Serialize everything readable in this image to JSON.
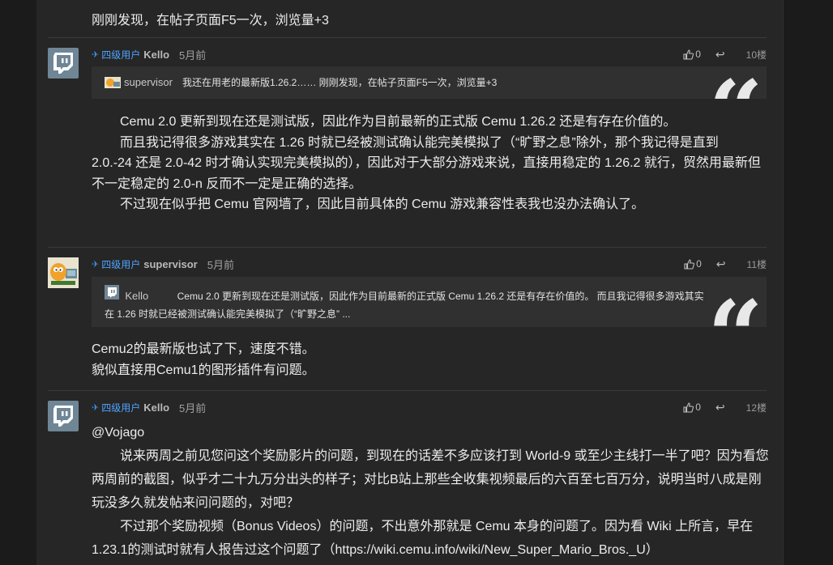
{
  "top_line": "刚刚发现，在帖子页面F5一次，浏览量+3",
  "colors": {
    "background": "#1b1b1b",
    "column": "#262626",
    "quote_bg": "#303030",
    "level": "#4da3ff"
  },
  "posts": [
    {
      "level": "四级用户",
      "user": "Kello",
      "time": "5月前",
      "likes": "0",
      "floor": "10楼",
      "avatar_icon": "twitch-icon",
      "quote": {
        "user": "supervisor",
        "text": "我还在用老的最新版1.26.2…… 刚刚发现，在帖子页面F5一次，浏览量+3"
      },
      "body": [
        "Cemu 2.0 更新到现在还是测试版，因此作为目前最新的正式版 Cemu 1.26.2 还是有存在价值的。",
        "而且我记得很多游戏其实在 1.26 时就已经被测试确认能完美模拟了（“旷野之息”除外，那个我记得是直到",
        " 2.0.-24 还是 2.0-42 时才确认实现完美模拟的），因此对于大部分游戏来说，直接用稳定的 1.26.2 就行，贸然用最新但不一定稳定的 2.0-n 反而不一定是正确的选择。",
        "不过现在似乎把 Cemu 官网墙了，因此目前具体的 Cemu 游戏兼容性表我也没办法确认了。"
      ]
    },
    {
      "level": "四级用户",
      "user": "supervisor",
      "time": "5月前",
      "likes": "0",
      "floor": "11楼",
      "avatar_icon": "garfield-avatar",
      "quote": {
        "user": "Kello",
        "text": "Cemu 2.0 更新到现在还是测试版，因此作为目前最新的正式版 Cemu 1.26.2 还是有存在价值的。 而且我记得很多游戏其实",
        "text2": "在 1.26 时就已经被测试确认能完美模拟了（“旷野之息” ..."
      },
      "body": [
        "Cemu2的最新版也试了下，速度不错。",
        "貌似直接用Cemu1的图形插件有问题。"
      ]
    },
    {
      "level": "四级用户",
      "user": "Kello",
      "time": "5月前",
      "likes": "0",
      "floor": "12楼",
      "avatar_icon": "twitch-icon",
      "body": [
        "@Vojago",
        "说来两周之前见您问这个奖励影片的问题，到现在的话差不多应该打到 World-9 或至少主线打一半了吧？因为看您两周前的截图，似乎才二十九万分出头的样子；对比B站上那些全收集视频最后的六百至七百万分，说明当时八成是刚玩没多久就发帖来问问题的，对吧？",
        "不过那个奖励视频（Bonus Videos）的问题，不出意外那就是 Cemu 本身的问题了。因为看 Wiki 上所言，早在1.23.1的测试时就有人报告过这个问题了（https://wiki.cemu.info/wiki/New_Super_Mario_Bros._U）"
      ]
    }
  ]
}
